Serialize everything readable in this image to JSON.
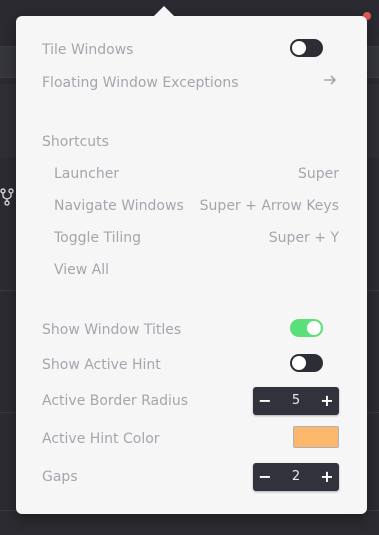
{
  "settings": {
    "tile_windows": {
      "label": "Tile Windows",
      "enabled": false
    },
    "floating_exceptions": {
      "label": "Floating Window Exceptions"
    },
    "shortcuts": {
      "heading": "Shortcuts",
      "items": [
        {
          "label": "Launcher",
          "keys": "Super"
        },
        {
          "label": "Navigate Windows",
          "keys": "Super + Arrow Keys"
        },
        {
          "label": "Toggle Tiling",
          "keys": "Super + Y"
        }
      ],
      "view_all": "View All"
    },
    "show_window_titles": {
      "label": "Show Window Titles",
      "enabled": true
    },
    "show_active_hint": {
      "label": "Show Active Hint",
      "enabled": false
    },
    "active_border_radius": {
      "label": "Active Border Radius",
      "value": "5",
      "minus": "−",
      "plus": "+"
    },
    "active_hint_color": {
      "label": "Active Hint Color",
      "color": "#FBB86C"
    },
    "gaps": {
      "label": "Gaps",
      "value": "2",
      "minus": "−",
      "plus": "+"
    }
  },
  "colors": {
    "toggle_on": "#59E07A",
    "toggle_off": "#2D2D36",
    "popover_bg": "#F6F6F7",
    "label_text": "#A5A5AD"
  },
  "icons": {
    "exceptions": "arrow-right-icon",
    "background_app": "branch-icon"
  }
}
